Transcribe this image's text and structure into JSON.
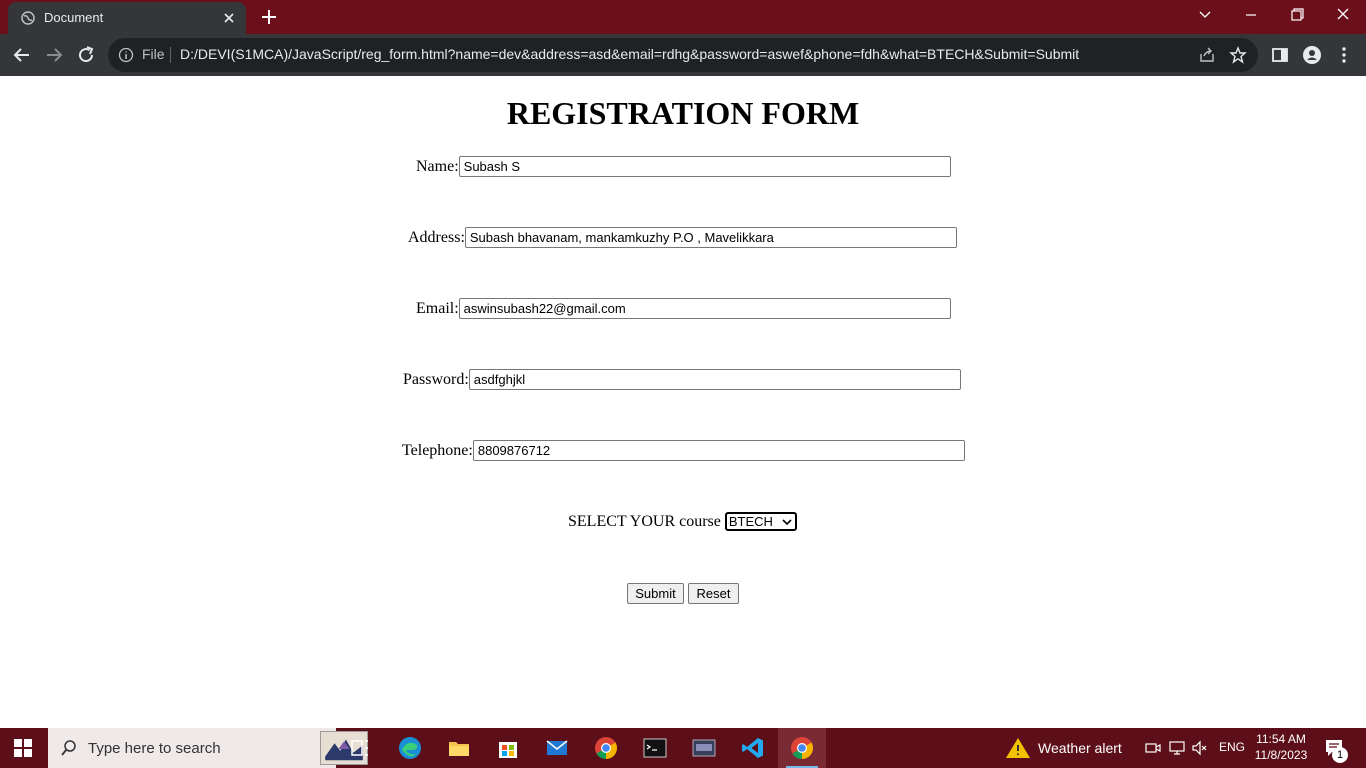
{
  "browser": {
    "tab_title": "Document",
    "file_label": "File",
    "url": "D:/DEVI(S1MCA)/JavaScript/reg_form.html?name=dev&address=asd&email=rdhg&password=aswef&phone=fdh&what=BTECH&Submit=Submit"
  },
  "form": {
    "heading": "REGISTRATION FORM",
    "name_label": "Name:",
    "name_value": "Subash S",
    "address_label": "Address:",
    "address_value": "Subash bhavanam, mankamkuzhy P.O , Mavelikkara",
    "email_label": "Email:",
    "email_value": "aswinsubash22@gmail.com",
    "password_label": "Password:",
    "password_value": "asdfghjkl",
    "telephone_label": "Telephone:",
    "telephone_value": "8809876712",
    "course_label": "SELECT YOUR course",
    "course_selected": "BTECH",
    "submit_label": "Submit",
    "reset_label": "Reset"
  },
  "taskbar": {
    "search_placeholder": "Type here to search",
    "weather_label": "Weather alert",
    "language": "ENG",
    "time": "11:54 AM",
    "date": "11/8/2023",
    "notification_count": "1"
  },
  "colors": {
    "title_bar": "#6b0f1a",
    "toolbar": "#35363a",
    "taskbar": "#5c0f18",
    "accent": "#76b9ed"
  },
  "icons": {
    "tab": [
      "globe-icon",
      "close-icon"
    ],
    "toolbar": [
      "back-arrow-icon",
      "forward-arrow-icon",
      "reload-icon",
      "info-icon",
      "share-icon",
      "star-icon",
      "side-panel-icon",
      "profile-icon",
      "more-vertical-icon"
    ],
    "window": [
      "chevron-down-icon",
      "minimize-icon",
      "restore-icon",
      "close-window-icon"
    ],
    "taskbar_apps": [
      "task-view-icon",
      "edge-icon",
      "file-explorer-icon",
      "microsoft-store-icon",
      "mail-icon",
      "chrome-icon",
      "terminal-icon",
      "sql-icon",
      "vscode-icon",
      "chrome-active-icon"
    ],
    "tray": [
      "weather-alert-icon",
      "meet-now-icon",
      "network-icon",
      "volume-muted-icon",
      "notification-icon"
    ]
  }
}
